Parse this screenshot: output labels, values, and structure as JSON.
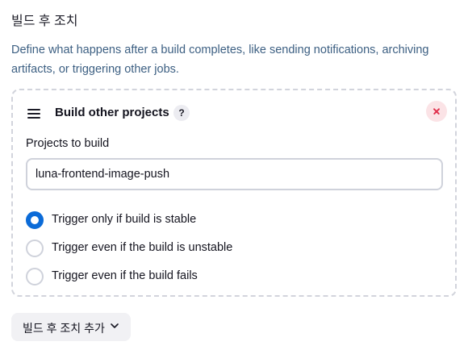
{
  "section": {
    "title": "빌드 후 조치",
    "description": "Define what happens after a build completes, like sending notifications, archiving artifacts, or triggering other jobs."
  },
  "card": {
    "drag_icon": "hamburger-icon",
    "title": "Build other projects",
    "help_label": "?",
    "close_icon": "close-icon",
    "projects_label": "Projects to build",
    "projects_value": "luna-frontend-image-push",
    "radio_options": [
      {
        "label": "Trigger only if build is stable",
        "checked": true
      },
      {
        "label": "Trigger even if the build is unstable",
        "checked": false
      },
      {
        "label": "Trigger even if the build fails",
        "checked": false
      }
    ]
  },
  "add_button": {
    "label": "빌드 후 조치 추가",
    "icon": "chevron-down-icon"
  },
  "colors": {
    "accent": "#0b6bd8",
    "danger": "#e0314d",
    "danger_bg": "#fbe3e6",
    "description_text": "#3c5f82",
    "border": "#cfd2db"
  }
}
